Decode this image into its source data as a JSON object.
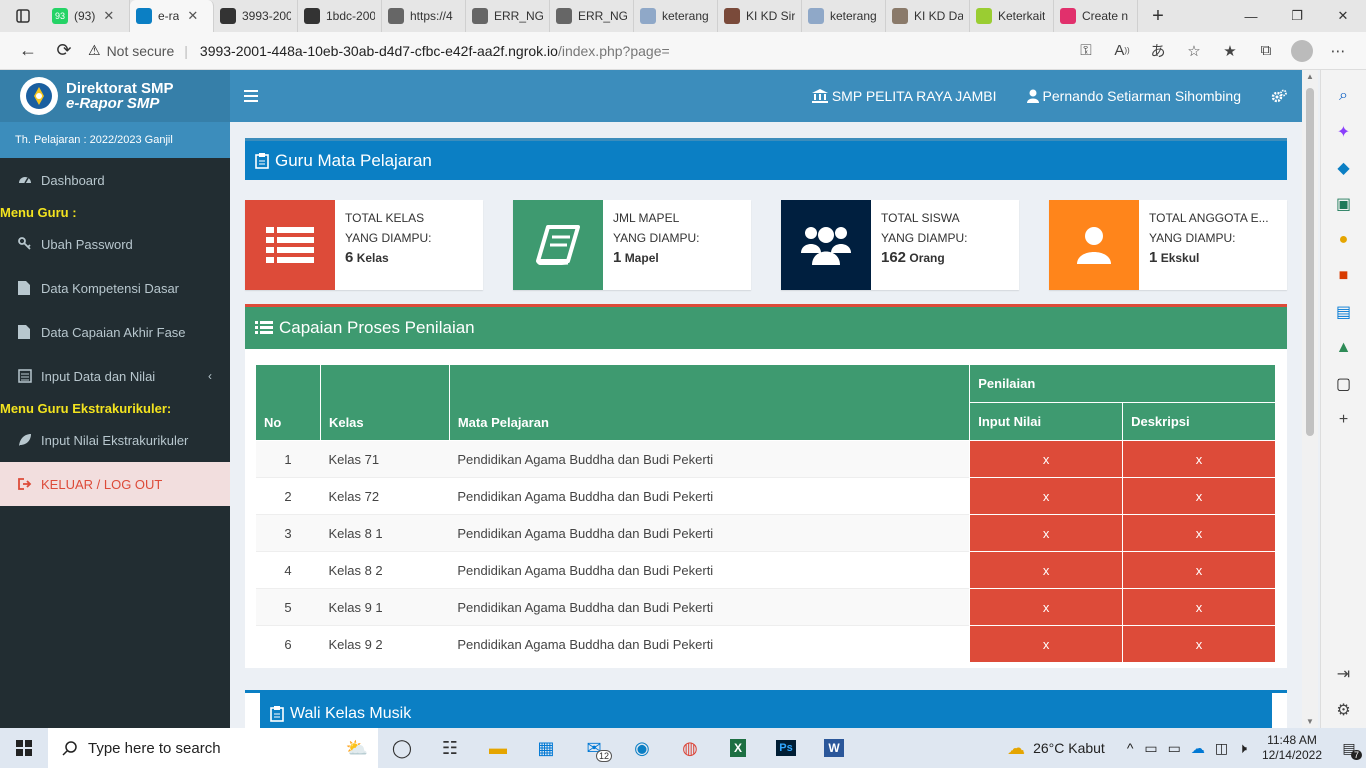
{
  "browser": {
    "tabs": [
      {
        "label": "(93)",
        "color": "#25d366"
      },
      {
        "label": "e-ra",
        "color": "#0b7fc4",
        "active": true
      },
      {
        "label": "3993-200",
        "color": "#333333"
      },
      {
        "label": "1bdc-200",
        "color": "#333333"
      },
      {
        "label": "https://4",
        "color": "#666666"
      },
      {
        "label": "ERR_NGF",
        "color": "#666666"
      },
      {
        "label": "ERR_NGF",
        "color": "#666666"
      },
      {
        "label": "keterang",
        "color": "#8fa8c8"
      },
      {
        "label": "KI KD Sir",
        "color": "#7a4a3a"
      },
      {
        "label": "keterang",
        "color": "#8fa8c8"
      },
      {
        "label": "KI KD Da",
        "color": "#8a7a6a"
      },
      {
        "label": "Keterkait",
        "color": "#9acd32"
      },
      {
        "label": "Create n",
        "color": "#e1306c"
      }
    ],
    "tab_badge": "93",
    "security_label": "Not secure",
    "url_host": "3993-2001-448a-10eb-30ab-d4d7-cfbc-e42f-aa2f.ngrok.io",
    "url_path": "/index.php?page="
  },
  "sidebar": {
    "logo_line1": "Direktorat SMP",
    "logo_line2": "e-Rapor SMP",
    "year": "Th. Pelajaran : 2022/2023 Ganjil",
    "dashboard": "Dashboard",
    "menu_guru_heading": "Menu Guru :",
    "ubah_password": "Ubah Password",
    "data_kompetensi": "Data Kompetensi Dasar",
    "data_capaian": "Data Capaian Akhir Fase",
    "input_data": "Input Data dan Nilai",
    "menu_ekskul_heading": "Menu Guru Ekstrakurikuler:",
    "input_ekskul": "Input Nilai Ekstrakurikuler",
    "logout": "KELUAR / LOG OUT"
  },
  "header": {
    "school": "SMP PELITA RAYA JAMBI",
    "user": "Pernando Setiarman Sihombing"
  },
  "main": {
    "guru_title": "Guru Mata Pelajaran",
    "info_boxes": [
      {
        "label1": "TOTAL KELAS",
        "label2": "YANG DIAMPU:",
        "value": "6",
        "unit": "Kelas",
        "color": "#dd4b39"
      },
      {
        "label1": "JML MAPEL",
        "label2": "YANG DIAMPU:",
        "value": "1",
        "unit": "Mapel",
        "color": "#3e9a70"
      },
      {
        "label1": "TOTAL SISWA",
        "label2": "YANG DIAMPU:",
        "value": "162",
        "unit": "Orang",
        "color": "#001f3f"
      },
      {
        "label1": "TOTAL ANGGOTA E...",
        "label2": "YANG DIAMPU:",
        "value": "1",
        "unit": "Ekskul",
        "color": "#ff851b"
      }
    ],
    "capaian_title": "Capaian Proses Penilaian",
    "table": {
      "col_no": "No",
      "col_kelas": "Kelas",
      "col_mapel": "Mata Pelajaran",
      "col_penilaian": "Penilaian",
      "col_input": "Input Nilai",
      "col_deskripsi": "Deskripsi",
      "rows": [
        {
          "no": "1",
          "kelas": "Kelas 71",
          "mapel": "Pendidikan Agama Buddha dan Budi Pekerti",
          "input": "x",
          "deskripsi": "x"
        },
        {
          "no": "2",
          "kelas": "Kelas 72",
          "mapel": "Pendidikan Agama Buddha dan Budi Pekerti",
          "input": "x",
          "deskripsi": "x"
        },
        {
          "no": "3",
          "kelas": "Kelas 8 1",
          "mapel": "Pendidikan Agama Buddha dan Budi Pekerti",
          "input": "x",
          "deskripsi": "x"
        },
        {
          "no": "4",
          "kelas": "Kelas 8 2",
          "mapel": "Pendidikan Agama Buddha dan Budi Pekerti",
          "input": "x",
          "deskripsi": "x"
        },
        {
          "no": "5",
          "kelas": "Kelas 9 1",
          "mapel": "Pendidikan Agama Buddha dan Budi Pekerti",
          "input": "x",
          "deskripsi": "x"
        },
        {
          "no": "6",
          "kelas": "Kelas 9 2",
          "mapel": "Pendidikan Agama Buddha dan Budi Pekerti",
          "input": "x",
          "deskripsi": "x"
        }
      ]
    },
    "wali_title": "Wali Kelas Musik"
  },
  "taskbar": {
    "search_placeholder": "Type here to search",
    "mail_badge": "12",
    "weather": "26°C  Kabut",
    "time": "11:48 AM",
    "date": "12/14/2022",
    "notif_count": "7"
  }
}
